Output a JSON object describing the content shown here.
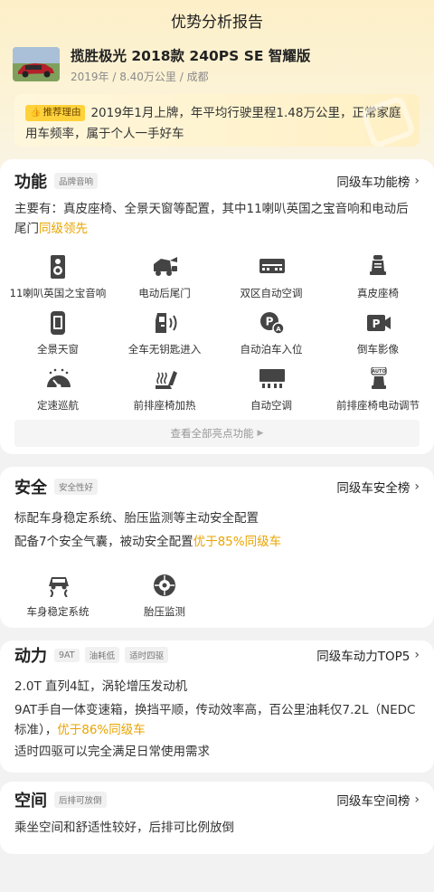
{
  "page": {
    "title": "优势分析报告"
  },
  "car": {
    "name": "揽胜极光 2018款 240PS SE 智耀版",
    "meta": "2019年 / 8.40万公里 / 成都"
  },
  "reason": {
    "badge": "推荐理由",
    "text": "2019年1月上牌，年平均行驶里程1.48万公里，正常家庭用车频率，属于个人一手好车"
  },
  "function": {
    "title": "功能",
    "tag": "品牌音响",
    "link": "同级车功能榜",
    "desc_pre": "主要有：真皮座椅、全景天窗等配置，其中11喇叭英国之宝音响和电动后尾门",
    "desc_hl": "同级领先",
    "items": [
      {
        "label": "11喇叭英国之宝音响",
        "icon": "speaker-icon"
      },
      {
        "label": "电动后尾门",
        "icon": "power-tailgate-icon"
      },
      {
        "label": "双区自动空调",
        "icon": "dual-zone-ac-icon"
      },
      {
        "label": "真皮座椅",
        "icon": "leather-seat-icon"
      },
      {
        "label": "全景天窗",
        "icon": "panoramic-sunroof-icon"
      },
      {
        "label": "全车无钥匙进入",
        "icon": "keyless-entry-icon"
      },
      {
        "label": "自动泊车入位",
        "icon": "auto-parking-icon"
      },
      {
        "label": "倒车影像",
        "icon": "reverse-camera-icon"
      },
      {
        "label": "定速巡航",
        "icon": "cruise-control-icon"
      },
      {
        "label": "前排座椅加热",
        "icon": "seat-heating-icon"
      },
      {
        "label": "自动空调",
        "icon": "auto-ac-icon"
      },
      {
        "label": "前排座椅电动调节",
        "icon": "power-seat-icon"
      }
    ],
    "more": "查看全部亮点功能"
  },
  "safety": {
    "title": "安全",
    "tag": "安全性好",
    "link": "同级车安全榜",
    "line1": "标配车身稳定系统、胎压监测等主动安全配置",
    "line2_pre": "配备7个安全气囊，被动安全配置",
    "line2_hl": "优于85%同级车",
    "items": [
      {
        "label": "车身稳定系统",
        "icon": "stability-control-icon"
      },
      {
        "label": "胎压监测",
        "icon": "tire-pressure-icon"
      }
    ]
  },
  "power": {
    "title": "动力",
    "tags": [
      "9AT",
      "油耗低",
      "适时四驱"
    ],
    "link": "同级车动力TOP5",
    "line1": "2.0T 直列4缸，涡轮增压发动机",
    "line2_pre": "9AT手自一体变速箱，换挡平顺，传动效率高，百公里油耗仅7.2L（NEDC标准），",
    "line2_hl": "优于86%同级车",
    "line3": "适时四驱可以完全满足日常使用需求"
  },
  "space": {
    "title": "空间",
    "tag": "后排可放倒",
    "link": "同级车空间榜",
    "line1": "乘坐空间和舒适性较好，后排可比例放倒"
  },
  "colors": {
    "highlight": "#e9a400",
    "badge": "#ffd23b"
  }
}
